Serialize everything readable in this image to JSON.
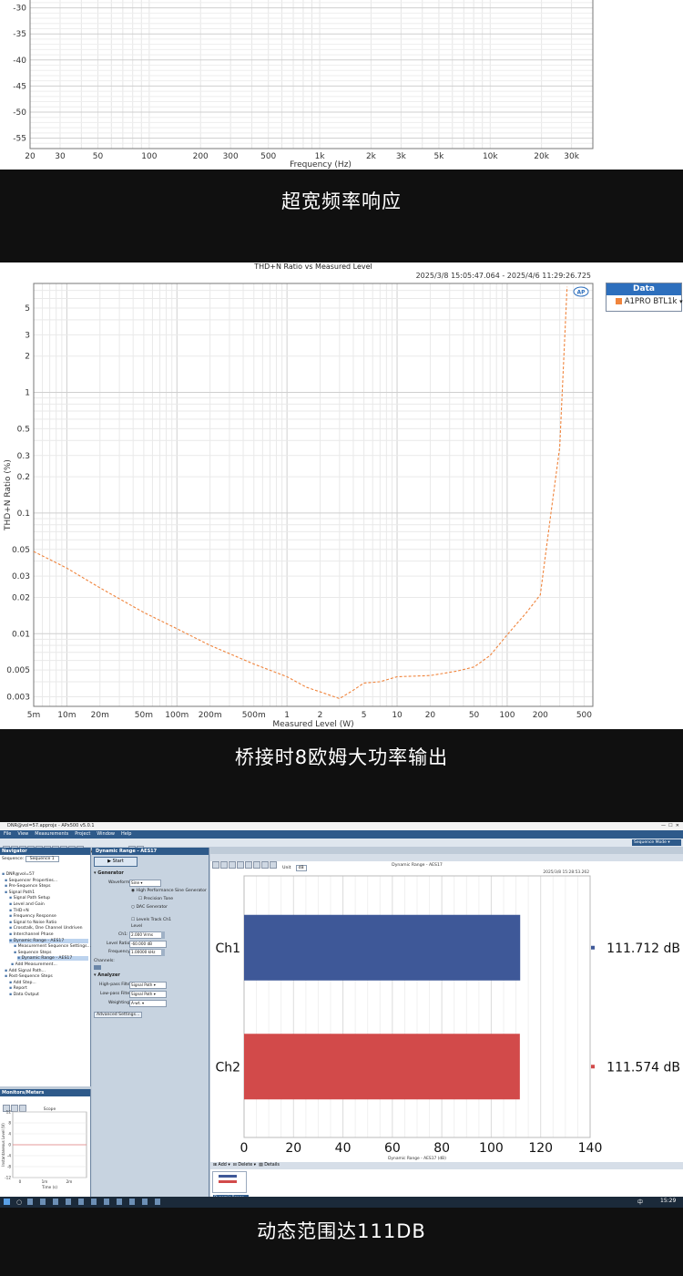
{
  "captions": {
    "freq_response": "超宽频率响应",
    "thd_power": "桥接时8欧姆大功率输出",
    "dynamic_range": "动态范围达111DB"
  },
  "chart_data": [
    {
      "type": "line",
      "title": "",
      "xlabel": "Frequency (Hz)",
      "ylabel": "",
      "x_scale": "log",
      "xlim": [
        20,
        40000
      ],
      "ylim": [
        -57,
        -25
      ],
      "x_tick_labels": [
        "20",
        "30",
        "50",
        "100",
        "200",
        "300",
        "500",
        "1k",
        "2k",
        "3k",
        "5k",
        "10k",
        "20k",
        "30k"
      ],
      "y_tick_labels": [
        "-30",
        "-35",
        "-40",
        "-45",
        "-50",
        "-55"
      ],
      "series": []
    },
    {
      "type": "line",
      "title": "THD+N Ratio vs Measured Level",
      "timestamp": "2025/3/8 15:05:47.064 -  2025/4/6 11:29:26.725",
      "xlabel": "Measured Level (W)",
      "ylabel": "THD+N Ratio (%)",
      "x_scale": "log",
      "y_scale": "log",
      "xlim": [
        0.005,
        600
      ],
      "ylim": [
        0.0025,
        8
      ],
      "x_tick_labels": [
        "5m",
        "10m",
        "20m",
        "50m",
        "100m",
        "200m",
        "500m",
        "1",
        "2",
        "5",
        "10",
        "20",
        "50",
        "100",
        "200",
        "500"
      ],
      "y_tick_labels": [
        "5",
        "3",
        "2",
        "1",
        "0.5",
        "0.3",
        "0.2",
        "0.1",
        "0.05",
        "0.03",
        "0.02",
        "0.01",
        "0.005",
        "0.003"
      ],
      "legend": {
        "title": "Data",
        "placement": "right"
      },
      "series": [
        {
          "name": "A1PRO BTL1k",
          "color": "#f0843c",
          "x": [
            0.005,
            0.01,
            0.02,
            0.05,
            0.1,
            0.2,
            0.5,
            1,
            1.5,
            2.2,
            3,
            4,
            5,
            7,
            10,
            20,
            35,
            50,
            70,
            100,
            150,
            200,
            250,
            300,
            350
          ],
          "y": [
            0.048,
            0.035,
            0.024,
            0.015,
            0.011,
            0.008,
            0.0056,
            0.0044,
            0.0036,
            0.0032,
            0.0029,
            0.0034,
            0.0039,
            0.004,
            0.0044,
            0.0045,
            0.0049,
            0.0053,
            0.0066,
            0.0098,
            0.015,
            0.021,
            0.1,
            0.35,
            7.5
          ]
        }
      ]
    },
    {
      "type": "bar",
      "orientation": "horizontal",
      "title": "Dynamic Range - AES17",
      "timestamp": "2025/3/8 15:28:53.262",
      "xlabel": "Dynamic Range - AES17 (dB)",
      "xlim": [
        0,
        140
      ],
      "x_tick_labels": [
        "0",
        "20",
        "40",
        "60",
        "80",
        "100",
        "120",
        "140"
      ],
      "categories": [
        "Ch1",
        "Ch2"
      ],
      "values": [
        111.712,
        111.574
      ],
      "value_labels": [
        "111.712 dB",
        "111.574 dB"
      ],
      "colors": [
        "#3e5898",
        "#d24a4a"
      ]
    }
  ],
  "app": {
    "title": "DNR@vol=57.approjx - APx500 v5.0.1",
    "menu": [
      "File",
      "View",
      "Measurements",
      "Project",
      "Window",
      "Help"
    ],
    "toolbar_label": "Audible Monitor",
    "sequence_mode": "Sequence Mode",
    "navigator": {
      "title": "Navigator",
      "sequence_label": "Sequence:",
      "sequence_value": "Sequence 1",
      "items": [
        "DNR@vol=57",
        "Sequencer Properties...",
        "Pre-Sequence Steps",
        "Signal Path1",
        "Signal Path Setup",
        "Level and Gain",
        "THD+N",
        "Frequency Response",
        "Signal to Noise Ratio",
        "Crosstalk, One Channel Undriven",
        "Interchannel Phase",
        "Dynamic Range - AES17",
        "Measurement Sequence Settings...",
        "Sequence Steps",
        "Dynamic Range - AES17",
        "Add Measurement...",
        "Add Signal Path...",
        "Post-Sequence Steps",
        "Add Step...",
        "Report",
        "Data Output"
      ]
    },
    "monitors": {
      "title": "Monitors/Meters",
      "scope_title": "Scope",
      "y_label": "Instantaneous Level (V)",
      "x_label": "Time (s)",
      "y_ticks": [
        "12",
        "8",
        "4",
        "0",
        "-4",
        "-8",
        "-12"
      ],
      "x_ticks": [
        "0",
        "1m",
        "2m"
      ]
    },
    "settings": {
      "title": "Dynamic Range - AES17",
      "start_button": "Start",
      "generator_header": "Generator",
      "waveform_label": "Waveform:",
      "waveform_value": "Sine",
      "opt_high_perf": "High Performance Sine Generator",
      "opt_precision": "Precision Tone",
      "opt_dac": "DAC Generator",
      "levels_track": "Levels Track Ch1",
      "level_label": "Level",
      "ch1_label": "Ch1:",
      "ch1_value": "2.000 Vrms",
      "level_ratio_label": "Level Ratio:",
      "level_ratio_value": "-60.000 dB",
      "frequency_label": "Frequency:",
      "frequency_value": "1.00000 kHz",
      "channels_label": "Channels:",
      "analyzer_header": "Analyzer",
      "hp_label": "High-pass Filter:",
      "hp_value": "Signal Path",
      "lp_label": "Low-pass Filter:",
      "lp_value": "Signal Path",
      "weighting_label": "Weighting:",
      "weighting_value": "A-wt.",
      "advanced_button": "Advanced Settings..."
    },
    "graph_toolbar": {
      "unit_label": "Unit",
      "unit_value": "dB"
    },
    "bottom_toolbar": {
      "add": "Add",
      "delete": "Delete",
      "details": "Details",
      "thumb_label": "Dynamic Range..."
    },
    "status": {
      "output_label": "Output:",
      "output_value": "Analog Unbalanced 2 Ch, 20 ohm",
      "input_label": "Input:",
      "input_value": "Analog Balanced 2 Ch, 200 kohm",
      "input_extra": "2.000 Vrms",
      "input_extra2": "AC (<10 Hz) - 20 kHz"
    },
    "taskbar": {
      "time": "15:29",
      "lang": "中"
    }
  }
}
